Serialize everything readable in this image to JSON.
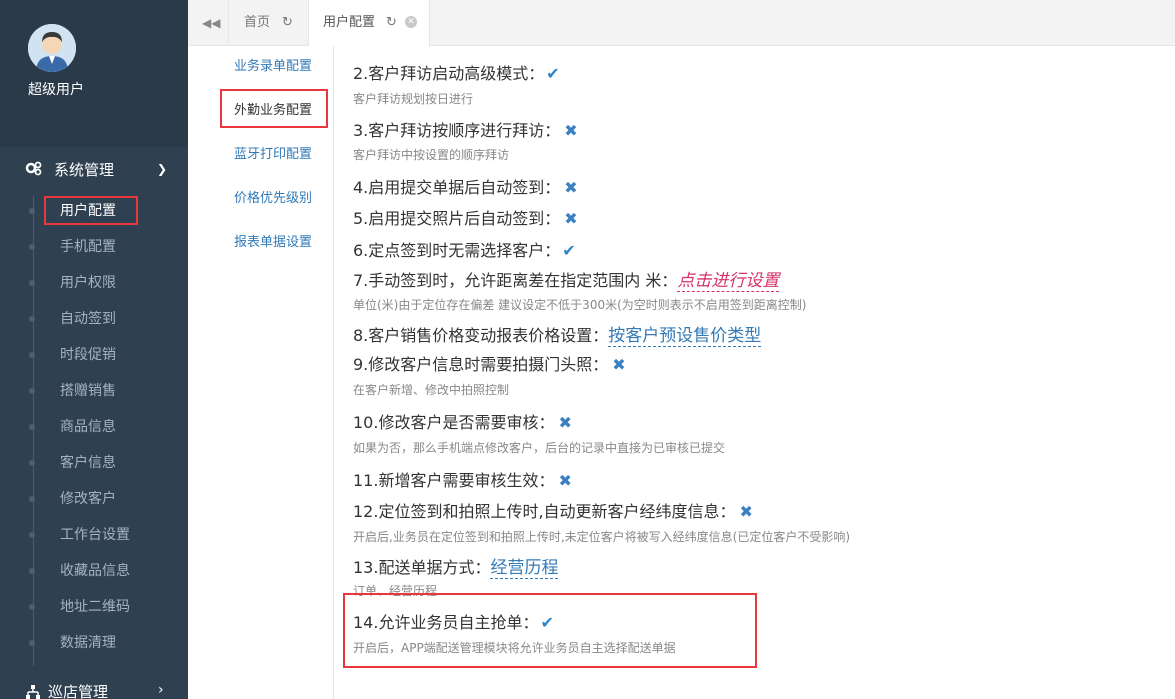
{
  "profile": {
    "username": "超级用户"
  },
  "sidebar": {
    "section": "系统管理",
    "items": [
      "用户配置",
      "手机配置",
      "用户权限",
      "自动签到",
      "时段促销",
      "搭赠销售",
      "商品信息",
      "客户信息",
      "修改客户",
      "工作台设置",
      "收藏品信息",
      "地址二维码",
      "数据清理"
    ],
    "section2": "巡店管理"
  },
  "tabs": {
    "home": "首页",
    "active": "用户配置"
  },
  "subnav": [
    "业务录单配置",
    "外勤业务配置",
    "蓝牙打印配置",
    "价格优先级别",
    "报表单据设置"
  ],
  "settings": [
    {
      "title": "2.客户拜访启动高级模式：",
      "mark": "check",
      "desc": "客户拜访规划按日进行"
    },
    {
      "title": "3.客户拜访按顺序进行拜访：",
      "mark": "cross",
      "desc": "客户拜访中按设置的顺序拜访"
    },
    {
      "title": "4.启用提交单据后自动签到：",
      "mark": "cross",
      "desc": ""
    },
    {
      "title": "5.启用提交照片后自动签到：",
      "mark": "cross",
      "desc": ""
    },
    {
      "title": "6.定点签到时无需选择客户：",
      "mark": "check",
      "desc": ""
    },
    {
      "title": "7.手动签到时，允许距离差在指定范围内 米：",
      "link_red": "点击进行设置",
      "desc": "单位(米)由于定位存在偏差 建议设定不低于300米(为空时则表示不启用签到距离控制)"
    },
    {
      "title": "8.客户销售价格变动报表价格设置：",
      "link_blue": "按客户预设售价类型",
      "desc": ""
    },
    {
      "title": "9.修改客户信息时需要拍摄门头照：",
      "mark": "cross",
      "desc": "在客户新增、修改中拍照控制"
    },
    {
      "title": "10.修改客户是否需要审核：",
      "mark": "cross",
      "desc": "如果为否，那么手机端点修改客户，后台的记录中直接为已审核已提交"
    },
    {
      "title": "11.新增客户需要审核生效：",
      "mark": "cross",
      "desc": ""
    },
    {
      "title": "12.定位签到和拍照上传时,自动更新客户经纬度信息：",
      "mark": "cross",
      "desc": "开启后,业务员在定位签到和拍照上传时,未定位客户将被写入经纬度信息(已定位客户不受影响)"
    },
    {
      "title": "13.配送单据方式：",
      "link_blue": "经营历程",
      "desc": "订单、经营历程"
    },
    {
      "title": "14.允许业务员自主抢单：",
      "mark": "check",
      "desc": "开启后，APP端配送管理模块将允许业务员自主选择配送单据"
    }
  ],
  "icons": {
    "check": "✔",
    "cross": "✖"
  }
}
